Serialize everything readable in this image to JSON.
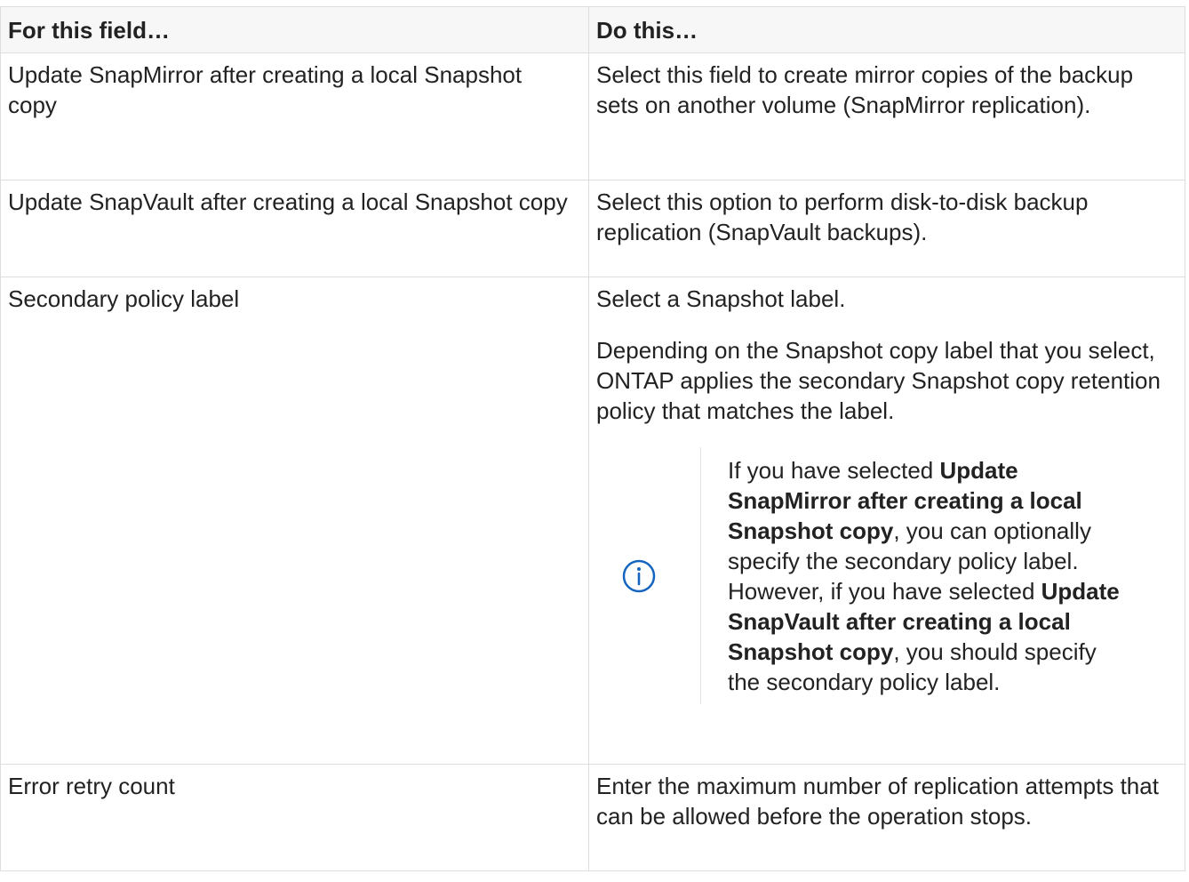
{
  "table": {
    "headers": {
      "field": "For this field…",
      "action": "Do this…"
    },
    "rows": [
      {
        "field": "Update SnapMirror after creating a local Snapshot copy",
        "action": "Select this field to create mirror copies of the backup sets on another volume (SnapMirror replication)."
      },
      {
        "field": "Update SnapVault after creating a local Snapshot copy",
        "action": "Select this option to perform disk-to-disk backup replication (SnapVault backups)."
      },
      {
        "field": "Secondary policy label",
        "action_p1": "Select a Snapshot label.",
        "action_p2": "Depending on the Snapshot copy label that you select, ONTAP applies the secondary Snapshot copy retention policy that matches the label.",
        "note": {
          "icon": "info-circle-icon",
          "icon_color": "#1565c0",
          "t1": "If you have selected ",
          "b1": "Update SnapMirror after creating a local Snapshot copy",
          "t2": ", you can optionally specify the secondary policy label. However, if you have selected ",
          "b2": "Update SnapVault after creating a local Snapshot copy",
          "t3": ", you should specify the secondary policy label."
        }
      },
      {
        "field": "Error retry count",
        "action": "Enter the maximum number of replication attempts that can be allowed before the operation stops."
      }
    ]
  }
}
